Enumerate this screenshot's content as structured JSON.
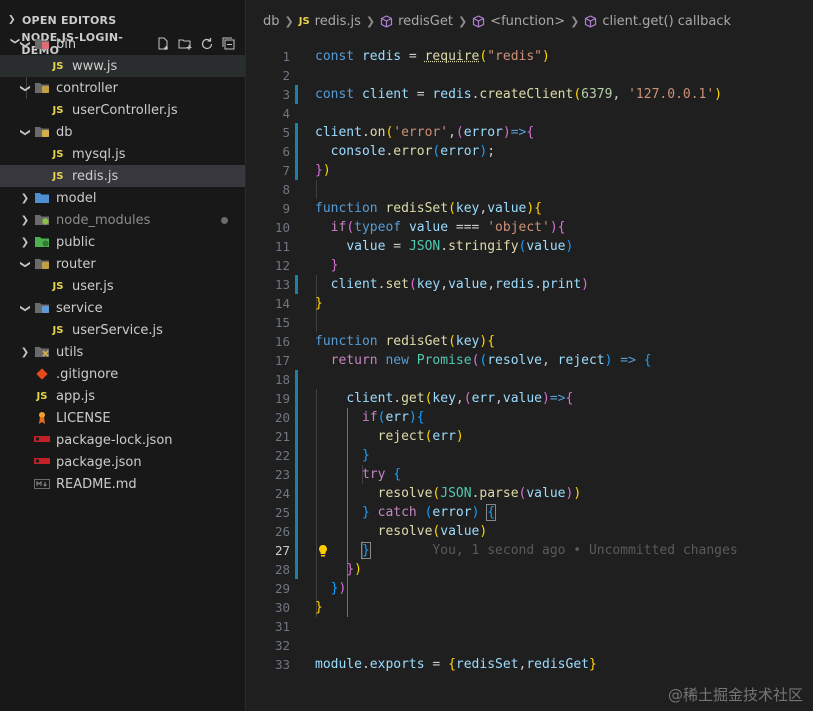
{
  "sidebar": {
    "open_editors": "OPEN EDITORS",
    "project": "NODE.JS-LOGIN-DEMO",
    "tree": [
      {
        "label": "bin",
        "kind": "folder",
        "depth": 0,
        "open": true,
        "color": "#e06c75"
      },
      {
        "label": "www.js",
        "kind": "js",
        "depth": 1,
        "hover": true
      },
      {
        "label": "controller",
        "kind": "folder",
        "depth": 0,
        "open": true,
        "color": "#c0a040"
      },
      {
        "label": "userController.js",
        "kind": "js",
        "depth": 1
      },
      {
        "label": "db",
        "kind": "folder",
        "depth": 0,
        "open": true,
        "color": "#d4b04a"
      },
      {
        "label": "mysql.js",
        "kind": "js",
        "depth": 1
      },
      {
        "label": "redis.js",
        "kind": "js",
        "depth": 1,
        "selected": true
      },
      {
        "label": "model",
        "kind": "folder",
        "depth": 0,
        "open": false,
        "color": "#4d8fd1"
      },
      {
        "label": "node_modules",
        "kind": "folder",
        "depth": 0,
        "open": false,
        "color": "#8bc34a",
        "dim": true,
        "dot": true
      },
      {
        "label": "public",
        "kind": "folder",
        "depth": 0,
        "open": false,
        "color": "#4caf50"
      },
      {
        "label": "router",
        "kind": "folder",
        "depth": 0,
        "open": true,
        "color": "#c0a040"
      },
      {
        "label": "user.js",
        "kind": "js",
        "depth": 1
      },
      {
        "label": "service",
        "kind": "folder",
        "depth": 0,
        "open": true,
        "color": "#5c9bd8"
      },
      {
        "label": "userService.js",
        "kind": "js",
        "depth": 1
      },
      {
        "label": "utils",
        "kind": "folder",
        "depth": 0,
        "open": false,
        "color": "#8d6e63"
      },
      {
        "label": ".gitignore",
        "kind": "git",
        "depth": 0
      },
      {
        "label": "app.js",
        "kind": "js",
        "depth": 0
      },
      {
        "label": "LICENSE",
        "kind": "license",
        "depth": 0
      },
      {
        "label": "package-lock.json",
        "kind": "npm",
        "depth": 0
      },
      {
        "label": "package.json",
        "kind": "npm",
        "depth": 0
      },
      {
        "label": "README.md",
        "kind": "md",
        "depth": 0
      }
    ]
  },
  "breadcrumb": {
    "folder": "db",
    "file": "redis.js",
    "fn1": "redisGet",
    "fn2": "<function>",
    "fn3": "client.get() callback",
    "js_badge": "JS"
  },
  "editor": {
    "active_line": 27,
    "blame": "You, 1 second ago • Uncommitted changes",
    "lines": [
      "1",
      "2",
      "3",
      "4",
      "5",
      "6",
      "7",
      "8",
      "9",
      "10",
      "11",
      "12",
      "13",
      "14",
      "15",
      "16",
      "17",
      "18",
      "19",
      "20",
      "21",
      "22",
      "23",
      "24",
      "25",
      "26",
      "27",
      "28",
      "29",
      "30",
      "31",
      "32",
      "33"
    ]
  },
  "watermark": "@稀土掘金技术社区"
}
